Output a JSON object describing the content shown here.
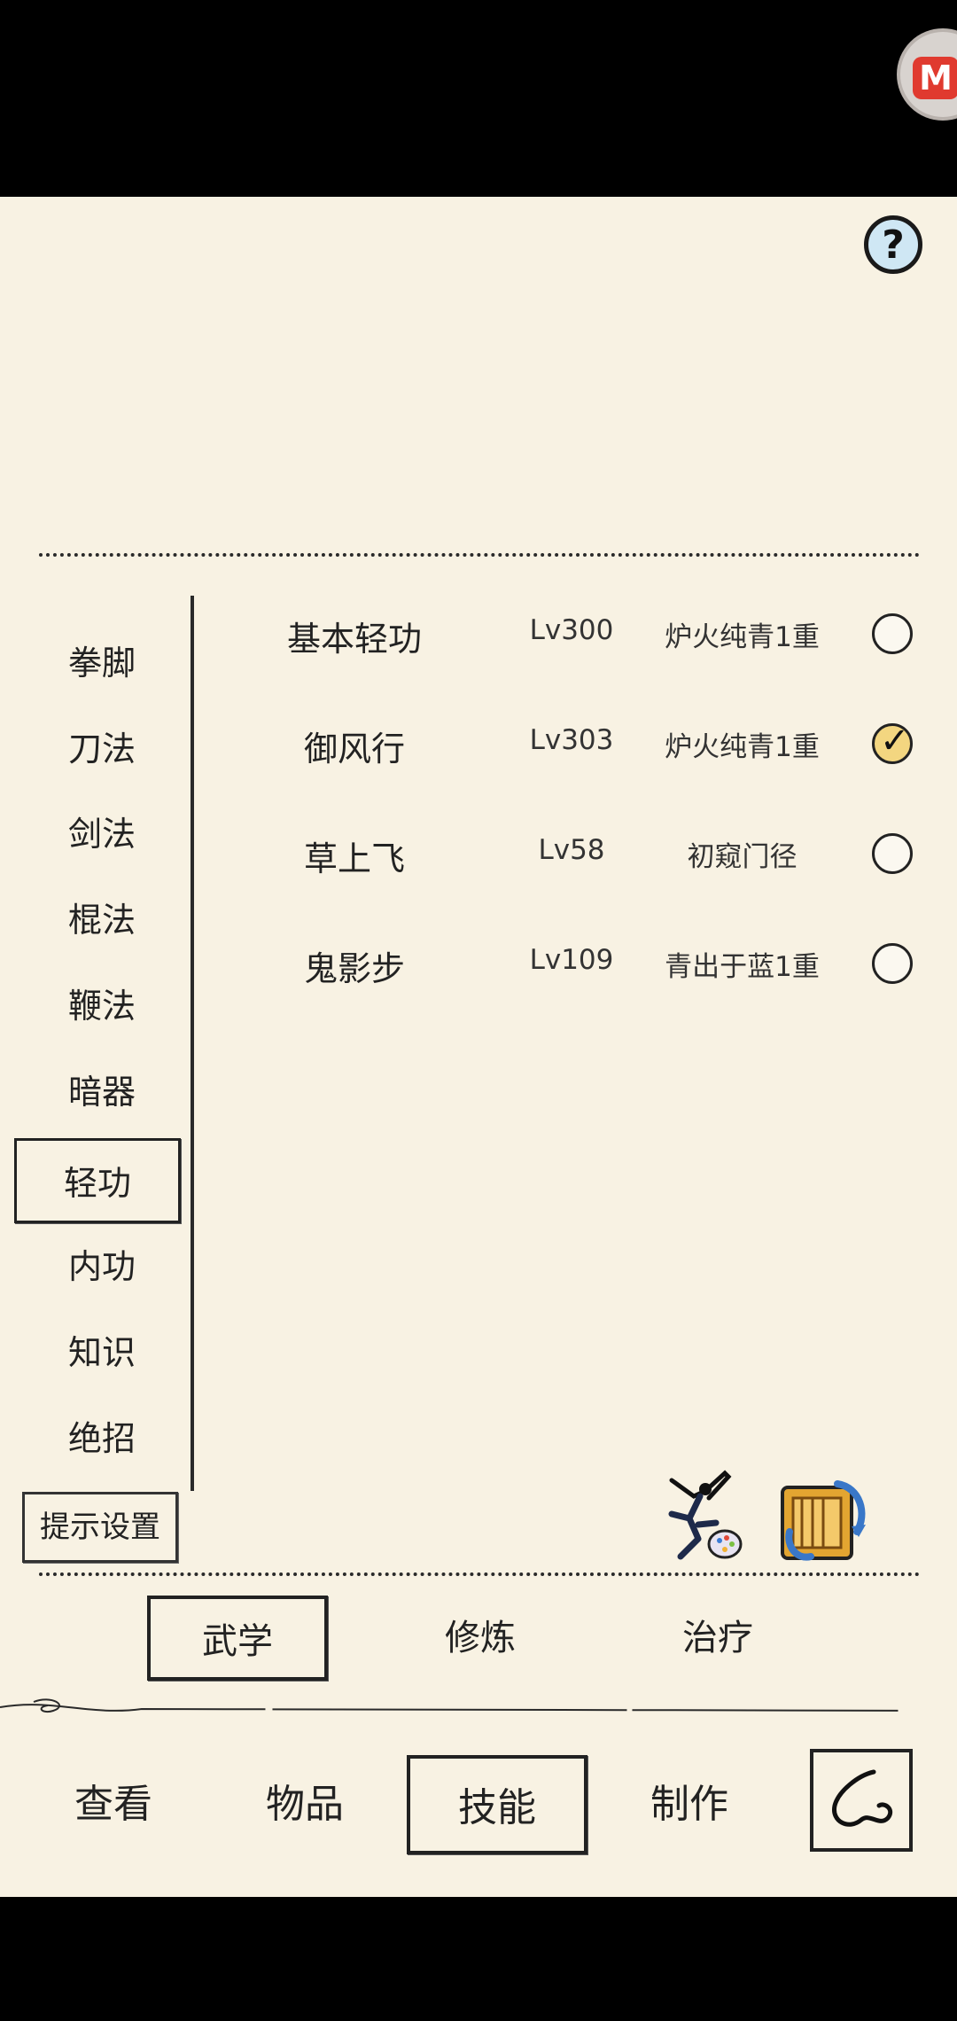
{
  "status_area": {
    "app_badge_letter": "M"
  },
  "help_button": {
    "label": "?"
  },
  "categories": [
    {
      "label": "拳脚",
      "selected": false
    },
    {
      "label": "刀法",
      "selected": false
    },
    {
      "label": "剑法",
      "selected": false
    },
    {
      "label": "棍法",
      "selected": false
    },
    {
      "label": "鞭法",
      "selected": false
    },
    {
      "label": "暗器",
      "selected": false
    },
    {
      "label": "轻功",
      "selected": true
    },
    {
      "label": "内功",
      "selected": false
    },
    {
      "label": "知识",
      "selected": false
    },
    {
      "label": "绝招",
      "selected": false
    }
  ],
  "hint_settings_label": "提示设置",
  "skills": [
    {
      "name": "基本轻功",
      "level": "Lv300",
      "rank": "炉火纯青1重",
      "checked": false
    },
    {
      "name": "御风行",
      "level": "Lv303",
      "rank": "炉火纯青1重",
      "checked": true
    },
    {
      "name": "草上飞",
      "level": "Lv58",
      "rank": "初窥门径",
      "checked": false
    },
    {
      "name": "鬼影步",
      "level": "Lv109",
      "rank": "青出于蓝1重",
      "checked": false
    }
  ],
  "sub_tabs": [
    {
      "label": "武学",
      "selected": true
    },
    {
      "label": "修炼",
      "selected": false
    },
    {
      "label": "治疗",
      "selected": false
    }
  ],
  "bottom_nav": [
    {
      "label": "查看",
      "selected": false
    },
    {
      "label": "物品",
      "selected": false
    },
    {
      "label": "技能",
      "selected": true
    },
    {
      "label": "制作",
      "selected": false
    }
  ],
  "icons": {
    "help": "question-icon",
    "martial_figure": "fighter-icon",
    "scroll": "scroll-swap-icon",
    "back": "back-icon"
  },
  "colors": {
    "background": "#f8f2e3",
    "ink": "#222222",
    "check_fill": "#f3d680",
    "help_fill": "#cfe7f4"
  }
}
